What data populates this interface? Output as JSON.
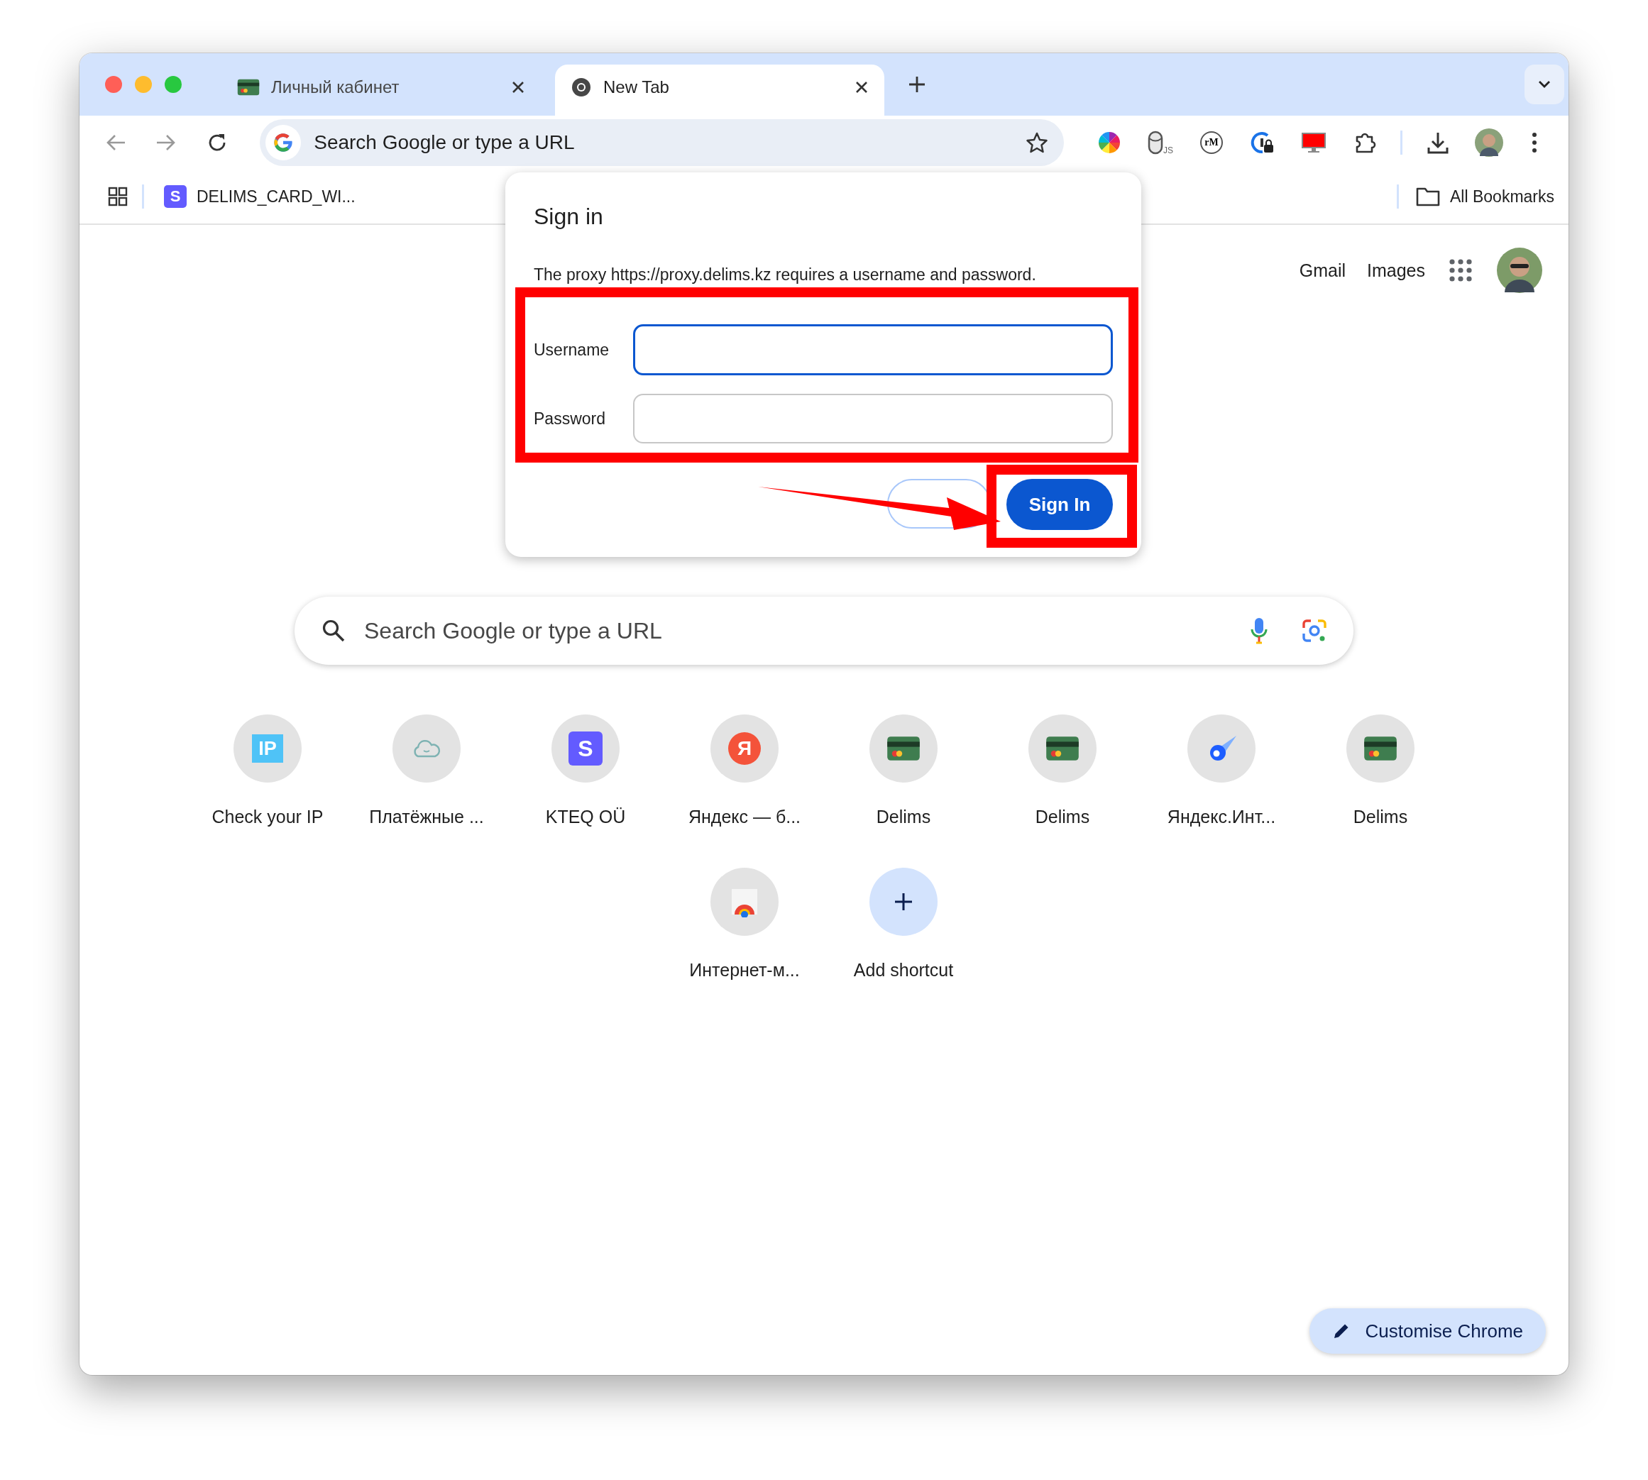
{
  "tabs": [
    {
      "title": "Личный кабинет",
      "selected": false,
      "kind": "card"
    },
    {
      "title": "New Tab",
      "selected": true,
      "kind": "chrome"
    }
  ],
  "omnibox": {
    "placeholder": "Search Google or type a URL"
  },
  "extensions": [
    {
      "kind": "colorwheel"
    },
    {
      "kind": "db",
      "glyph": "JS"
    },
    {
      "kind": "circle",
      "glyph": "rM"
    },
    {
      "kind": "lock"
    },
    {
      "kind": "monitor"
    },
    {
      "kind": "puzzle"
    }
  ],
  "bookmarks": [
    {
      "label": "DELIMS_CARD_WI...",
      "glyph": "S"
    }
  ],
  "all_bookmarks": "All Bookmarks",
  "dialog": {
    "title": "Sign in",
    "message": "The proxy https://proxy.delims.kz requires a username and password.",
    "fields": [
      {
        "label": "Username",
        "focused": true
      },
      {
        "label": "Password",
        "focused": false
      }
    ],
    "submit": "Sign In"
  },
  "header_links": [
    "Gmail",
    "Images"
  ],
  "search": {
    "placeholder": "Search Google or type a URL"
  },
  "shortcuts": [
    {
      "label": "Check your IP",
      "kind": "ip",
      "glyph": "IP"
    },
    {
      "label": "Платёжные ...",
      "kind": "cloud"
    },
    {
      "label": "KTEQ OÜ",
      "kind": "stripe",
      "glyph": "S"
    },
    {
      "label": "Яндекс — б...",
      "kind": "yandex",
      "glyph": "Я"
    },
    {
      "label": "Delims",
      "kind": "card"
    },
    {
      "label": "Delims",
      "kind": "card"
    },
    {
      "label": "Яндекс.Инт...",
      "kind": "comet"
    },
    {
      "label": "Delims",
      "kind": "card"
    },
    {
      "label": "Интернет-м...",
      "kind": "store"
    },
    {
      "label": "Add shortcut",
      "kind": "add"
    }
  ],
  "customise": "Customise Chrome"
}
